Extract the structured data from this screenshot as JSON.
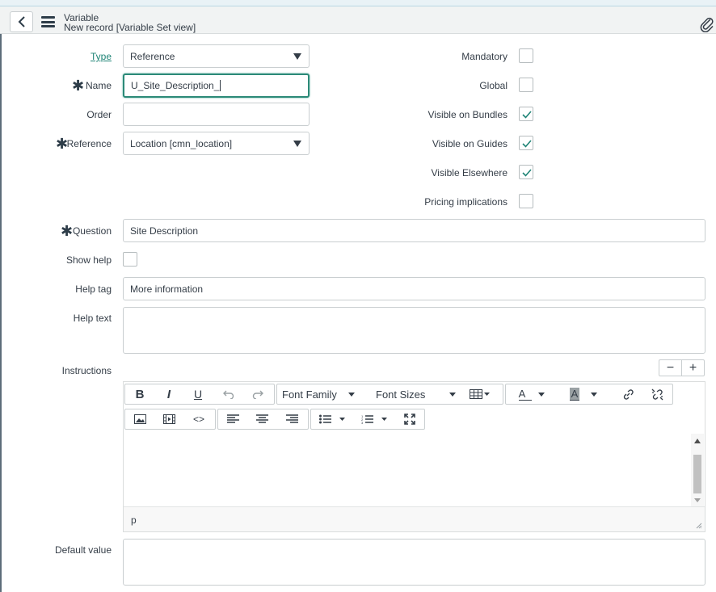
{
  "header": {
    "title": "Variable",
    "subtitle": "New record [Variable Set view]"
  },
  "form": {
    "type": {
      "label": "Type",
      "value": "Reference"
    },
    "name": {
      "label": "Name",
      "value": "U_Site_Description_"
    },
    "order": {
      "label": "Order",
      "value": ""
    },
    "reference": {
      "label": "Reference",
      "value": "Location [cmn_location]"
    },
    "question": {
      "label": "Question",
      "value": "Site Description"
    },
    "show_help": {
      "label": "Show help",
      "checked": false
    },
    "help_tag": {
      "label": "Help tag",
      "value": "More information"
    },
    "help_text": {
      "label": "Help text",
      "value": ""
    },
    "instructions": {
      "label": "Instructions"
    },
    "default_value": {
      "label": "Default value",
      "value": ""
    }
  },
  "checkboxes": {
    "mandatory": {
      "label": "Mandatory",
      "checked": false
    },
    "global": {
      "label": "Global",
      "checked": false
    },
    "visible_bundles": {
      "label": "Visible on Bundles",
      "checked": true
    },
    "visible_guides": {
      "label": "Visible on Guides",
      "checked": true
    },
    "visible_elsewhere": {
      "label": "Visible Elsewhere",
      "checked": true
    },
    "pricing": {
      "label": "Pricing implications",
      "checked": false
    }
  },
  "editor": {
    "bold": "B",
    "italic": "I",
    "underline": "U",
    "font_family": "Font Family",
    "font_sizes": "Font Sizes",
    "text_color": "A",
    "bg_color": "A",
    "code": "<>",
    "status_path": "p"
  },
  "zoom": {
    "minus": "−",
    "plus": "+"
  },
  "colors": {
    "accent": "#1f8476",
    "focus_border": "#2c8a78"
  }
}
